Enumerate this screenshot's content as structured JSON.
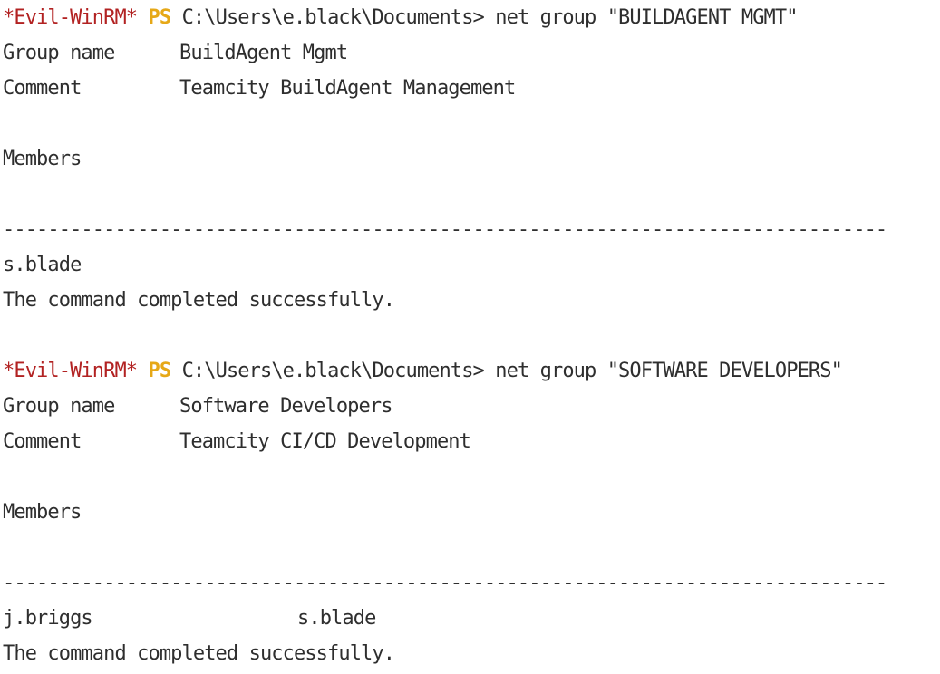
{
  "terminal": {
    "blocks": [
      {
        "prompt_host": "*Evil-WinRM*",
        "prompt_ps": "PS",
        "prompt_path": "C:\\Users\\e.black\\Documents>",
        "command": "net group \"BUILDAGENT MGMT\"",
        "group_name_label": "Group name",
        "group_name_value": "BuildAgent Mgmt",
        "comment_label": "Comment",
        "comment_value": "Teamcity BuildAgent Management",
        "members_label": "Members",
        "separator": "-------------------------------------------------------------------------------",
        "members": [
          "s.blade"
        ],
        "status": "The command completed successfully."
      },
      {
        "prompt_host": "*Evil-WinRM*",
        "prompt_ps": "PS",
        "prompt_path": "C:\\Users\\e.black\\Documents>",
        "command": "net group \"SOFTWARE DEVELOPERS\"",
        "group_name_label": "Group name",
        "group_name_value": "Software Developers",
        "comment_label": "Comment",
        "comment_value": "Teamcity CI/CD Development",
        "members_label": "Members",
        "separator": "-------------------------------------------------------------------------------",
        "members": [
          "j.briggs",
          "s.blade"
        ],
        "status": "The command completed successfully."
      }
    ]
  },
  "colors": {
    "prompt_host": "#b22222",
    "prompt_ps": "#e6a817",
    "text": "#2e2e2e",
    "background": "#ffffff"
  }
}
